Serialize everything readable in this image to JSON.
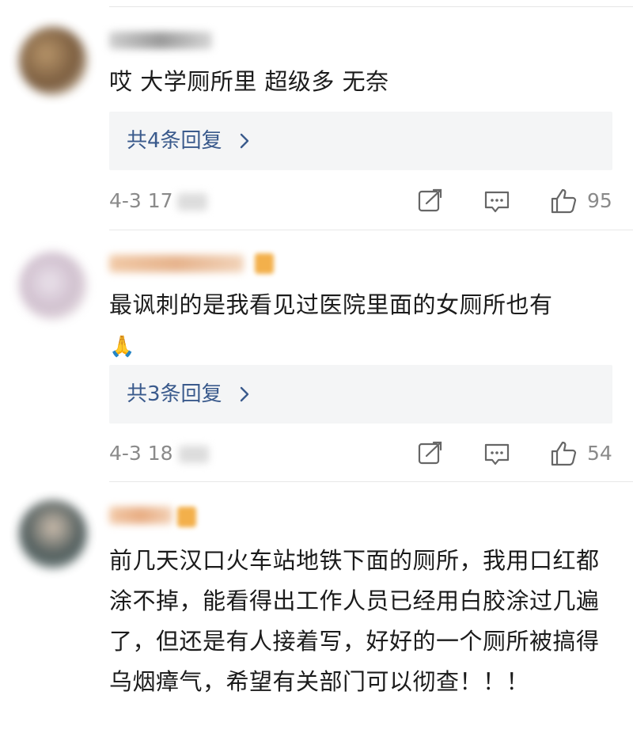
{
  "comments": [
    {
      "text": "哎 大学厕所里 超级多 无奈",
      "reply_label": "共4条回复",
      "time": "4-3 17",
      "like_count": "95"
    },
    {
      "text": "最讽刺的是我看见过医院里面的女厕所也有",
      "emoji": "🙏",
      "reply_label": "共3条回复",
      "time": "4-3 18",
      "like_count": "54"
    },
    {
      "text": "前几天汉口火车站地铁下面的厕所，我用口红都涂不掉，能看得出工作人员已经用白胶涂过几遍了，但还是有人接着写，好好的一个厕所被搞得乌烟瘴气，希望有关部门可以彻查！！！"
    }
  ],
  "icons": {
    "share": "share-icon",
    "comment": "comment-icon",
    "like": "like-icon",
    "chevron": "chevron-right-icon"
  },
  "colors": {
    "reply_link": "#3a5a8c",
    "meta_gray": "#8a8a8a",
    "reply_bg": "#f4f5f6"
  }
}
